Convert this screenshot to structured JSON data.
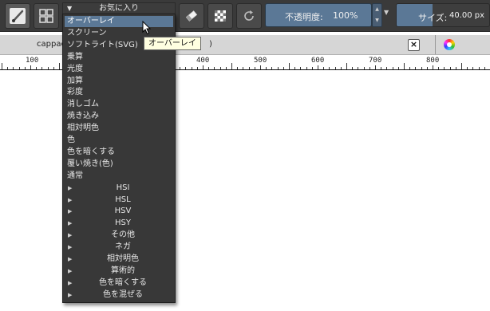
{
  "toolbar": {
    "favorites_label": "お気に入り",
    "opacity_label": "不透明度:",
    "opacity_value": "100%",
    "size_label": "サイズ:",
    "size_value": "40.00 px",
    "size_fill_fraction": 0.39
  },
  "tab": {
    "title_fragment": "cappac",
    "title_tail": ")",
    "close_label": "×"
  },
  "ruler": {
    "labels": [
      "100",
      "400",
      "500",
      "600",
      "700",
      "800"
    ]
  },
  "blend_menu": {
    "selected": "オーバーレイ",
    "items": [
      "オーバーレイ",
      "スクリーン",
      "ソフトライト(SVG)",
      "乗算",
      "光度",
      "加算",
      "彩度",
      "消しゴム",
      "焼き込み",
      "相対明色",
      "色",
      "色を暗くする",
      "覆い焼き(色)",
      "通常"
    ],
    "groups": [
      "HSI",
      "HSL",
      "HSV",
      "HSY",
      "その他",
      "ネガ",
      "相対明色",
      "算術的",
      "色を暗くする",
      "色を混ぜる"
    ]
  },
  "tooltip": {
    "text": "オーバーレイ"
  },
  "icons": {
    "brush": "brush-preset-icon",
    "grid": "preset-grid-icon",
    "eraser": "eraser-icon",
    "alpha": "preserve-alpha-icon",
    "reset": "reload-icon",
    "color": "color-wheel-icon"
  },
  "colors": {
    "accent": "#5b7896",
    "toolbar_bg": "#3a3a3a",
    "menu_bg": "#383838"
  }
}
